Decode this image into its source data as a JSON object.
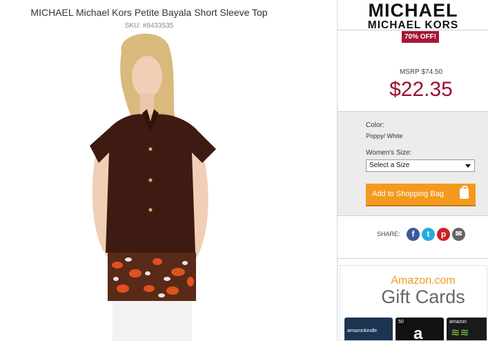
{
  "product": {
    "title": "MICHAEL Michael Kors Petite Bayala Short Sleeve Top",
    "sku": "SKU: #8433535"
  },
  "brand": {
    "line1": "MICHAEL",
    "line2": "MICHAEL KORS"
  },
  "badge": "70% OFF!",
  "pricing": {
    "msrp": "MSRP $74.50",
    "price": "$22.35"
  },
  "options": {
    "color_label": "Color:",
    "color_value": "Poppy/ White",
    "size_label": "Women's Size:",
    "size_selected": "Select a Size",
    "add_button": "Add to Shopping Bag"
  },
  "share": {
    "label": "SHARE:",
    "icons": [
      "facebook-icon",
      "twitter-icon",
      "pinterest-icon",
      "email-icon"
    ]
  },
  "gift_cards": {
    "line1": "Amazon.com",
    "line2": "Gift Cards",
    "card1": "amazonkindle",
    "card2": "50",
    "card3": "amazon"
  },
  "colors": {
    "price": "#9a0f2f",
    "badge": "#a51534",
    "button": "#f39a1e"
  }
}
